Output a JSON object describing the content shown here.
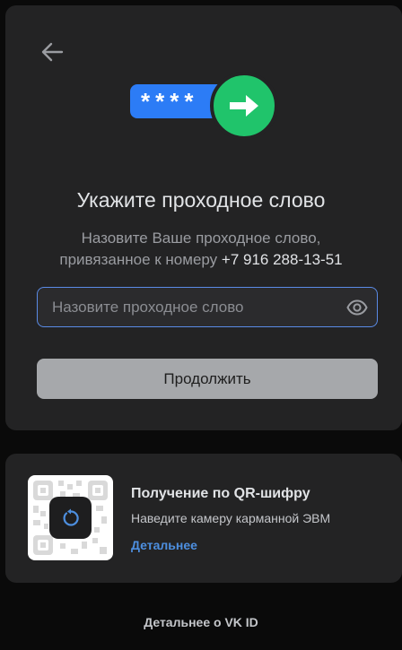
{
  "header": {
    "back_icon": "arrow-left-icon"
  },
  "hero": {
    "mask": "****",
    "arrow_icon": "arrow-right-icon",
    "accent_blue": "#2c7cf6",
    "accent_green": "#20c46b"
  },
  "main": {
    "title": "Укажите проходное слово",
    "subtitle_line1": "Назовите Ваше проходное слово,",
    "subtitle_line2": "привязанное к номеру",
    "phone": "+7 916 288-13-51",
    "password_placeholder": "Назовите проходное слово",
    "password_value": "",
    "eye_icon": "eye-icon",
    "continue_label": "Продолжить"
  },
  "qr": {
    "title": "Получение по QR-шифру",
    "subtitle": "Наведите камеру карманной ЭВМ",
    "link_label": "Детальнее",
    "refresh_icon": "refresh-icon",
    "link_color": "#4d8fe0"
  },
  "footer": {
    "link_label": "Детальнее о VK ID"
  }
}
